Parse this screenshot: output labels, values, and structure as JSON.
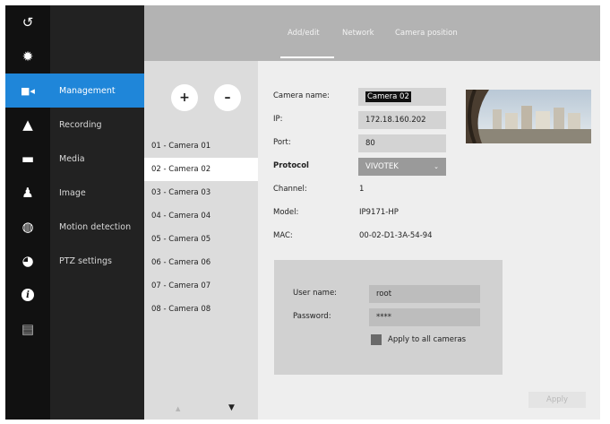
{
  "rail": {
    "items": [
      {
        "icon": "back-arrow-icon",
        "glyph": "↺"
      },
      {
        "icon": "gear-icon",
        "glyph": "✹"
      },
      {
        "icon": "camera-icon",
        "glyph": "■◂"
      },
      {
        "icon": "warning-icon",
        "glyph": "▲"
      },
      {
        "icon": "monitor-icon",
        "glyph": "▬"
      },
      {
        "icon": "person-icon",
        "glyph": "♟"
      },
      {
        "icon": "storage-icon",
        "glyph": "◍"
      },
      {
        "icon": "globe-icon",
        "glyph": "◕"
      },
      {
        "icon": "info-icon",
        "glyph": "i"
      },
      {
        "icon": "keyboard-icon",
        "glyph": "▤"
      }
    ]
  },
  "nav": {
    "items": [
      {
        "label": "Management"
      },
      {
        "label": "Recording"
      },
      {
        "label": "Media"
      },
      {
        "label": "Image"
      },
      {
        "label": "Motion detection"
      },
      {
        "label": "PTZ settings"
      }
    ],
    "active_index": 0
  },
  "tabs": [
    {
      "label": "Add/edit"
    },
    {
      "label": "Network"
    },
    {
      "label": "Camera position"
    }
  ],
  "camera_list": {
    "add_label": "+",
    "remove_label": "–",
    "items": [
      {
        "label": "01 - Camera 01"
      },
      {
        "label": "02 - Camera 02"
      },
      {
        "label": "03 - Camera 03"
      },
      {
        "label": "04 - Camera 04"
      },
      {
        "label": "05 - Camera 05"
      },
      {
        "label": "06 - Camera 06"
      },
      {
        "label": "07 - Camera 07"
      },
      {
        "label": "08 - Camera 08"
      }
    ],
    "selected_index": 1,
    "scroll_up_glyph": "▲",
    "scroll_down_glyph": "▼"
  },
  "form": {
    "camera_name": {
      "label": "Camera name:",
      "value": "Camera 02"
    },
    "ip": {
      "label": "IP:",
      "value": "172.18.160.202"
    },
    "port": {
      "label": "Port:",
      "value": "80"
    },
    "protocol": {
      "label": "Protocol",
      "value": "VIVOTEK"
    },
    "channel": {
      "label": "Channel:",
      "value": "1"
    },
    "model": {
      "label": "Model:",
      "value": "IP9171-HP"
    },
    "mac": {
      "label": "MAC:",
      "value": "00-02-D1-3A-54-94"
    }
  },
  "credentials": {
    "username": {
      "label": "User name:",
      "value": "root"
    },
    "password": {
      "label": "Password:",
      "value": "****"
    },
    "apply_all_label": "Apply to all cameras"
  },
  "apply_label": "Apply",
  "colors": {
    "accent": "#1f86d9",
    "rail_bg": "#111111",
    "nav_bg": "#222222",
    "topbar_bg": "#b3b3b3"
  }
}
